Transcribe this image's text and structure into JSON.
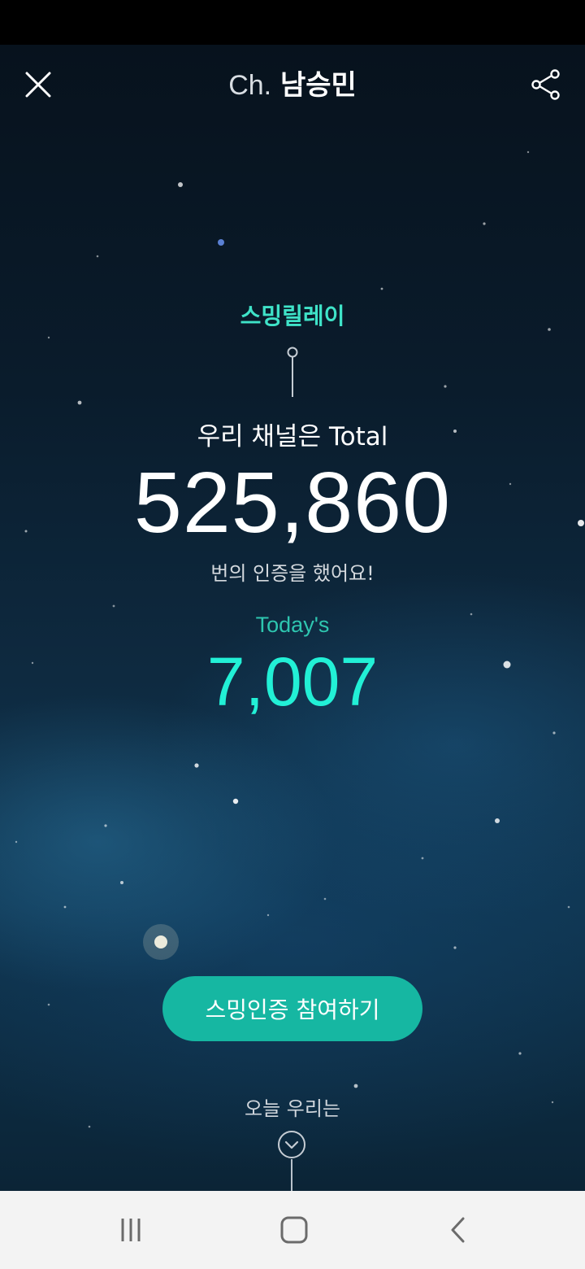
{
  "header": {
    "channel_prefix": "Ch.",
    "channel_name": "남승민"
  },
  "relay": {
    "label": "스밍릴레이",
    "total_intro": "우리 채널은 Total",
    "total_count": "525,860",
    "total_suffix": "번의 인증을 했어요!",
    "today_label": "Today's",
    "today_count": "7,007"
  },
  "actions": {
    "join_button": "스밍인증 참여하기",
    "today_we": "오늘 우리는"
  },
  "icons": {
    "close": "close-icon",
    "share": "share-icon",
    "scroll_down": "chevron-down-icon",
    "recents": "recents-icon",
    "home": "home-icon",
    "back": "back-icon"
  },
  "colors": {
    "accent": "#22f0d6",
    "button": "#16b7a2"
  }
}
